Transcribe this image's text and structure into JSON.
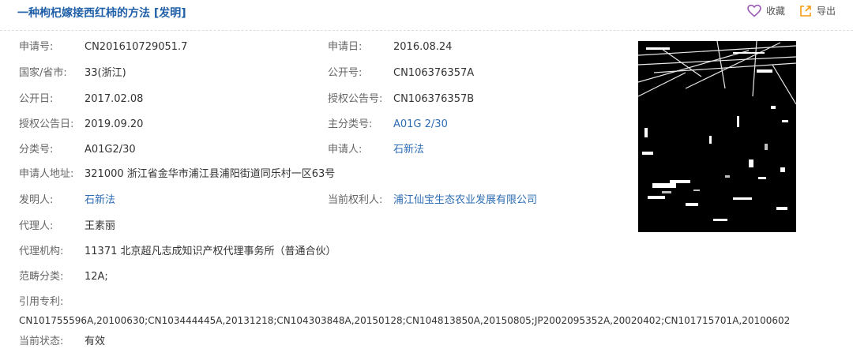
{
  "title": "一种枸杞嫁接西红柿的方法 [发明]",
  "actions": {
    "favorite": "收藏",
    "export": "导出"
  },
  "left_fields": [
    {
      "label": "申请号:",
      "value": "CN201610729051.7"
    },
    {
      "label": "国家/省市:",
      "value": "33(浙江)"
    },
    {
      "label": "公开日:",
      "value": "2017.02.08"
    },
    {
      "label": "授权公告日:",
      "value": "2019.09.20"
    },
    {
      "label": "分类号:",
      "value": "A01G2/30"
    },
    {
      "label": "申请人地址:",
      "value": "321000 浙江省金华市浦江县浦阳街道同乐村一区63号"
    },
    {
      "label": "发明人:",
      "value": "石新法"
    },
    {
      "label": "代理人:",
      "value": "王素丽"
    },
    {
      "label": "代理机构:",
      "value": "11371 北京超凡志成知识产权代理事务所（普通合伙）"
    },
    {
      "label": "范畴分类:",
      "value": "12A;"
    }
  ],
  "right_fields": [
    {
      "label": "申请日:",
      "value": "2016.08.24"
    },
    {
      "label": "公开号:",
      "value": "CN106376357A"
    },
    {
      "label": "授权公告号:",
      "value": "CN106376357B"
    },
    {
      "label": "主分类号:",
      "value": "A01G 2/30"
    },
    {
      "label": "申请人:",
      "value": "石新法"
    },
    {
      "label": "当前权利人:",
      "value": "浦江仙宝生态农业发展有限公司"
    }
  ],
  "citations": {
    "label": "引用专利:",
    "value": "CN101755596A,20100630;CN103444445A,20131218;CN104303848A,20150128;CN104813850A,20150805;JP2002095352A,20020402;CN101715701A,20100602"
  },
  "status": {
    "label": "当前状态:",
    "value": "有效"
  },
  "colors": {
    "title": "#1f5fa8",
    "link": "#2e6db4",
    "favorite_icon": "#9b59b6",
    "export_icon": "#f39c12"
  }
}
